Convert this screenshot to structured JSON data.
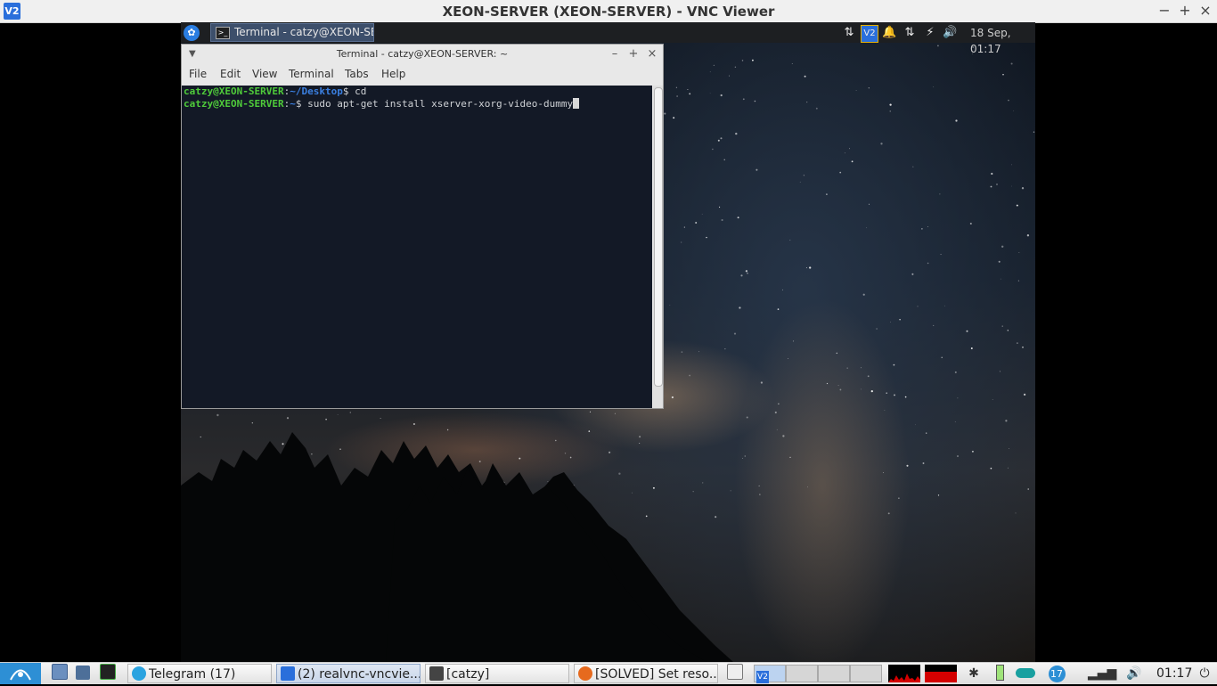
{
  "vnc": {
    "title": "XEON-SERVER (XEON-SERVER) - VNC Viewer",
    "app_icon": "V2",
    "controls": {
      "minimize": "−",
      "maximize": "+",
      "close": "×"
    }
  },
  "top_panel": {
    "task_label": "Terminal - catzy@XEON-SER...",
    "clock": "18 Sep, 01:17",
    "tray_icons": [
      "network-transfer-icon",
      "vnc-icon",
      "bell-icon",
      "network-transfer-icon",
      "power-icon",
      "volume-icon"
    ],
    "vnc_tray_label": "V2"
  },
  "terminal": {
    "title": "Terminal - catzy@XEON-SERVER: ~",
    "menu": [
      "File",
      "Edit",
      "View",
      "Terminal",
      "Tabs",
      "Help"
    ],
    "lines": [
      {
        "user": "catzy@XEON-SERVER",
        "sep": ":",
        "path": "~/Desktop",
        "dollar": "$ ",
        "command": "cd"
      },
      {
        "user": "catzy@XEON-SERVER",
        "sep": ":",
        "path": "~",
        "dollar": "$ ",
        "command": "sudo apt-get install xserver-xorg-video-dummy"
      }
    ]
  },
  "taskbar": {
    "tasks": [
      {
        "label": "Telegram (17)",
        "icon": "telegram-icon"
      },
      {
        "label": "(2) realvnc-vncvie...",
        "icon": "vnc-icon"
      },
      {
        "label": "[catzy]",
        "icon": "folder-icon"
      },
      {
        "label": "[SOLVED] Set reso...",
        "icon": "firefox-icon"
      }
    ],
    "badge_count": "17",
    "clock": "01:17",
    "vnc_ws_label": "V2"
  },
  "colors": {
    "prompt_user": "#4fcb3a",
    "prompt_path": "#3a7fe0",
    "terminal_bg": "#131926",
    "active_task": "#3d4f6b"
  }
}
